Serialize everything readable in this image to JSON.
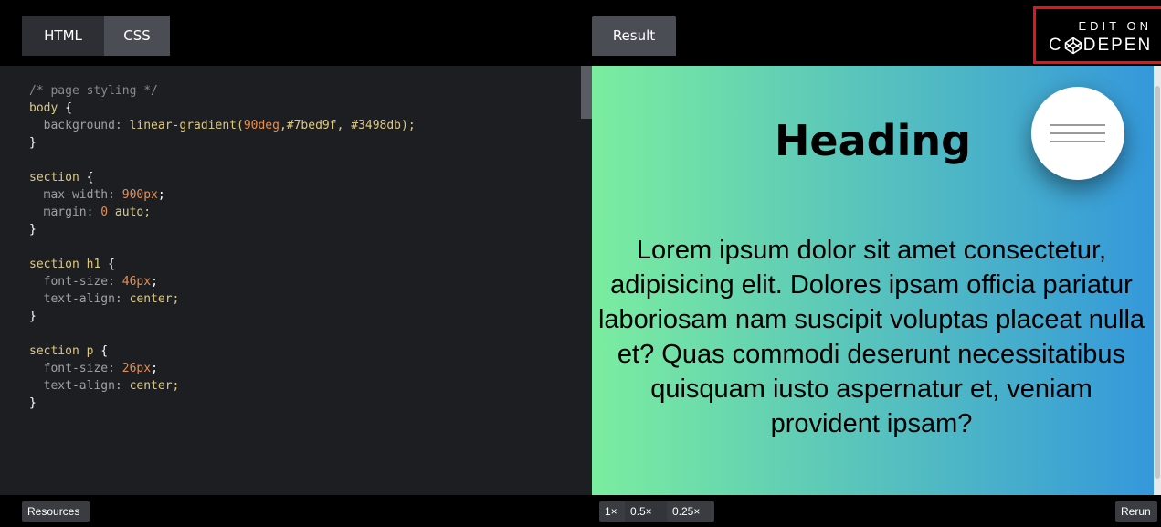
{
  "tabs": {
    "html": "HTML",
    "css": "CSS",
    "result": "Result"
  },
  "codepen": {
    "edit_on": "EDIT ON",
    "logo_left": "C",
    "logo_right": "DEPEN"
  },
  "code_lines": [
    [
      {
        "t": "/* page styling */",
        "c": "comment"
      }
    ],
    [
      {
        "t": "body ",
        "c": "sel"
      },
      {
        "t": "{",
        "c": "punct"
      }
    ],
    [
      {
        "t": "  background: ",
        "c": "prop"
      },
      {
        "t": "linear-gradient(",
        "c": "val"
      },
      {
        "t": "90deg",
        "c": "num"
      },
      {
        "t": ",#7bed9f, #3498db);",
        "c": "val"
      }
    ],
    [
      {
        "t": "}",
        "c": "punct"
      }
    ],
    [],
    [
      {
        "t": "section ",
        "c": "sel"
      },
      {
        "t": "{",
        "c": "punct"
      }
    ],
    [
      {
        "t": "  max-width: ",
        "c": "prop"
      },
      {
        "t": "900px",
        "c": "num"
      },
      {
        "t": ";",
        "c": "punct"
      }
    ],
    [
      {
        "t": "  margin: ",
        "c": "prop"
      },
      {
        "t": "0",
        "c": "num"
      },
      {
        "t": " auto;",
        "c": "val"
      }
    ],
    [
      {
        "t": "}",
        "c": "punct"
      }
    ],
    [],
    [
      {
        "t": "section h1 ",
        "c": "sel"
      },
      {
        "t": "{",
        "c": "punct"
      }
    ],
    [
      {
        "t": "  font-size: ",
        "c": "prop"
      },
      {
        "t": "46px",
        "c": "num"
      },
      {
        "t": ";",
        "c": "punct"
      }
    ],
    [
      {
        "t": "  text-align: ",
        "c": "prop"
      },
      {
        "t": "center;",
        "c": "val"
      }
    ],
    [
      {
        "t": "}",
        "c": "punct"
      }
    ],
    [],
    [
      {
        "t": "section p ",
        "c": "sel"
      },
      {
        "t": "{",
        "c": "punct"
      }
    ],
    [
      {
        "t": "  font-size: ",
        "c": "prop"
      },
      {
        "t": "26px",
        "c": "num"
      },
      {
        "t": ";",
        "c": "punct"
      }
    ],
    [
      {
        "t": "  text-align: ",
        "c": "prop"
      },
      {
        "t": "center;",
        "c": "val"
      }
    ],
    [
      {
        "t": "}",
        "c": "punct"
      }
    ]
  ],
  "result": {
    "heading": "Heading",
    "paragraph": "Lorem ipsum dolor sit amet consectetur, adipisicing elit. Dolores ipsam officia pariatur laboriosam nam suscipit voluptas placeat nulla et? Quas commodi deserunt necessitatibus quisquam iusto aspernatur et, veniam provident ipsam?"
  },
  "bottom": {
    "resources": "Resources",
    "zoom_1x": "1×",
    "zoom_05x": "0.5×",
    "zoom_025x": "0.25×",
    "rerun": "Rerun"
  },
  "colors": {
    "gradient_start": "#7bed9f",
    "gradient_end": "#3498db",
    "badge_border": "#e3141b"
  },
  "icons": [
    "codepen-logo-icon",
    "hamburger-menu-icon"
  ]
}
